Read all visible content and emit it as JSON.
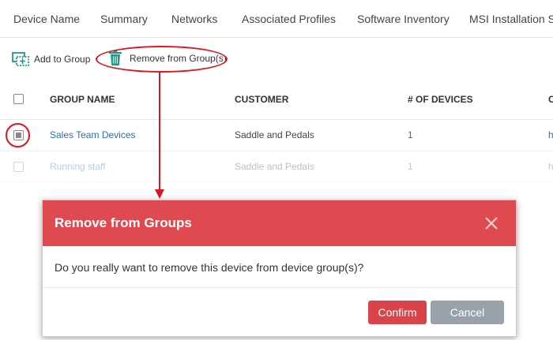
{
  "tabs": [
    "Device Name",
    "Summary",
    "Networks",
    "Associated Profiles",
    "Software Inventory",
    "MSI Installation St"
  ],
  "toolbar": {
    "add_label": "Add to Group",
    "remove_label": "Remove from Group(s)"
  },
  "table": {
    "headers": [
      "GROUP NAME",
      "CUSTOMER",
      "# OF DEVICES",
      "C"
    ],
    "rows": [
      {
        "group": "Sales Team Devices",
        "customer": "Saddle and Pedals",
        "devices": "1",
        "extra": "h"
      },
      {
        "group": "Running staff",
        "customer": "Saddle and Pedals",
        "devices": "1",
        "extra": "h"
      }
    ]
  },
  "modal": {
    "title": "Remove from Groups",
    "message": "Do you really want to remove this device from device group(s)?",
    "confirm_label": "Confirm",
    "cancel_label": "Cancel"
  },
  "colors": {
    "header_red": "#de4a4f",
    "confirm_red": "#d9434a",
    "cancel_gray": "#99a2ab",
    "link_blue": "#2a6ebb",
    "annotation_red": "#e0141e",
    "icon_green": "#1f9a8a"
  }
}
